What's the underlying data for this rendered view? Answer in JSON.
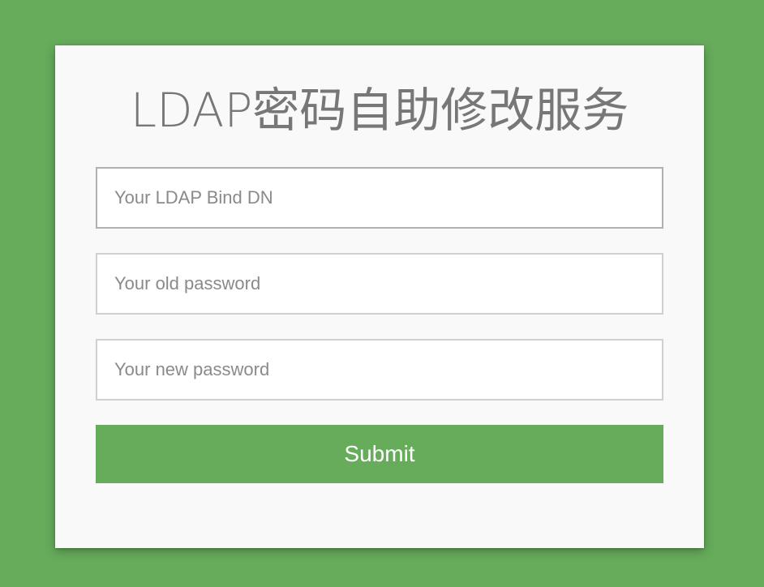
{
  "form": {
    "title": "LDAP密码自助修改服务",
    "fields": [
      {
        "name": "bind-dn",
        "value": "",
        "placeholder": "Your LDAP Bind DN",
        "focused": true
      },
      {
        "name": "old-password",
        "value": "",
        "placeholder": "Your old password",
        "focused": false
      },
      {
        "name": "new-password",
        "value": "",
        "placeholder": "Your new password",
        "focused": false
      }
    ],
    "submit_label": "Submit"
  },
  "colors": {
    "background": "#66ac5b",
    "card": "#f9f9f9",
    "accent": "#66ac5b",
    "title_text": "#777777",
    "placeholder_text": "#8a8a8a",
    "input_border": "#d0d0d0"
  }
}
